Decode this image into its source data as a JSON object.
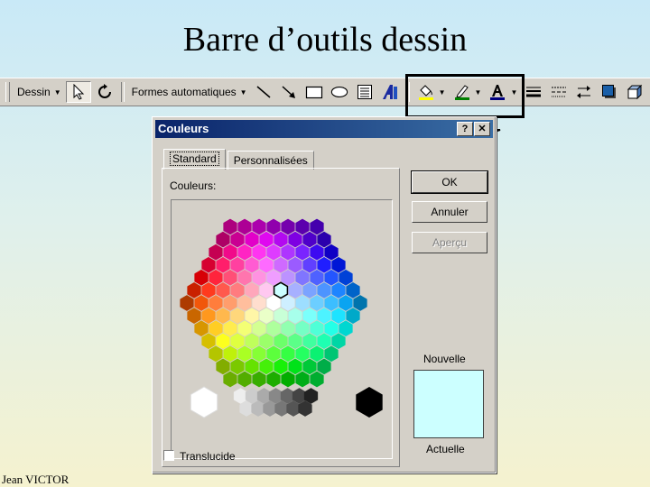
{
  "slide": {
    "title": "Barre d’outils dessin",
    "author": "Jean VICTOR"
  },
  "toolbar": {
    "draw_menu_label": "Dessin",
    "autoshapes_label": "Formes automatiques"
  },
  "dialog": {
    "title": "Couleurs",
    "help_button": "?",
    "tabs": [
      {
        "label": "Standard",
        "active": true
      },
      {
        "label": "Personnalisées",
        "active": false
      }
    ],
    "colors_label": "Couleurs:",
    "ok_label": "OK",
    "cancel_label": "Annuler",
    "preview_label": "Aperçu",
    "new_label": "Nouvelle",
    "current_label": "Actuelle",
    "translucent_label": "Translucide",
    "new_color": "#ccffff"
  },
  "colors": {
    "title_bar_start": "#0a246a",
    "title_bar_end": "#3a6ea5",
    "fill_color_bar": "#ffff00",
    "line_color_bar": "#008000",
    "font_color_bar": "#000080"
  }
}
